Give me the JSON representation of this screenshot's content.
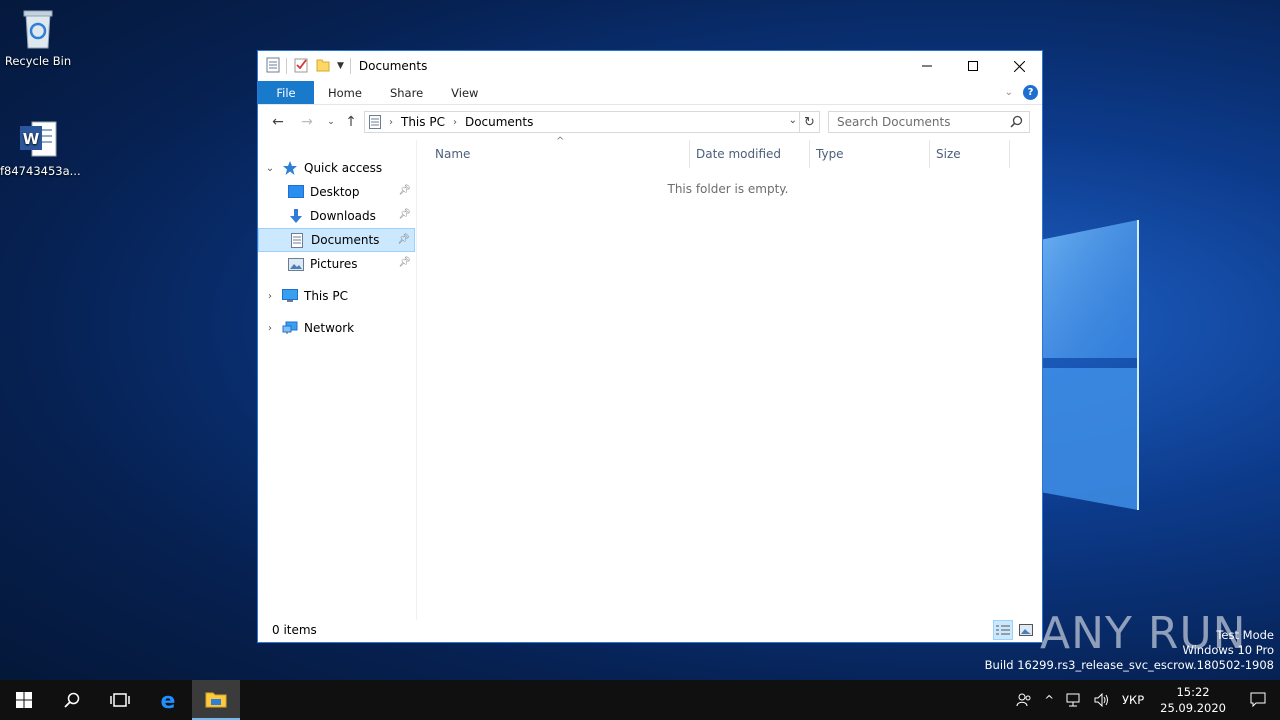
{
  "desktop": {
    "icons": [
      {
        "label": "Recycle Bin",
        "icon": "recycle-bin-icon"
      },
      {
        "label": "f84743453a...",
        "icon": "word-document-icon"
      }
    ]
  },
  "window": {
    "title": "Documents",
    "ribbon_tabs": [
      "File",
      "Home",
      "Share",
      "View"
    ],
    "address": {
      "root": "This PC",
      "current": "Documents"
    },
    "search_placeholder": "Search Documents",
    "columns": [
      "Name",
      "Date modified",
      "Type",
      "Size"
    ],
    "empty_message": "This folder is empty.",
    "status": "0 items",
    "nav": {
      "quick_access": "Quick access",
      "items": [
        "Desktop",
        "Downloads",
        "Documents",
        "Pictures"
      ],
      "selected": "Documents",
      "this_pc": "This PC",
      "network": "Network"
    }
  },
  "watermark": {
    "line1": "Test Mode",
    "line2": "Windows 10 Pro",
    "line3": "Build 16299.rs3_release_svc_escrow.180502-1908",
    "brand": "ANY RUN"
  },
  "taskbar": {
    "language": "УКР",
    "time": "15:22",
    "date": "25.09.2020"
  },
  "colors": {
    "accent": "#1979ca",
    "selection": "#cce8ff",
    "taskbar": "#101010"
  }
}
